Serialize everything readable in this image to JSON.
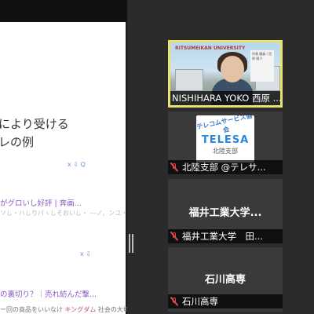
{
  "shared_screen": {
    "slide_lines": [
      "により受ける",
      "レの例"
    ],
    "ctrl_1": "x  ⇩  Q",
    "link_1": "がグロいし好評 | 奔画...",
    "faint_1": "ソし・ハしりパヽしそおいし・  ―ノ、ンユ・",
    "ctrl_2": "x  ⇩",
    "link_2": "の裏切り？｜売れ紡んだ撃...",
    "bottom_prefix": "ー回の商品をいいなけ ",
    "bottom_highlight": "キングダム",
    "bottom_suffix": " 社会の大切"
  },
  "participants": [
    {
      "name": "NISHIHARA YOKO 西原 ...",
      "type": "video",
      "active": true,
      "video_logo": "RITSUMEIKAN UNIVERSITY",
      "video_card": "所属 職員 / 西原 陽子"
    },
    {
      "name": "北陸支部 @テレサ...",
      "type": "avatar",
      "muted": true,
      "avatar_arc": "テレコムサービス協会",
      "avatar_brand": "TELESA",
      "avatar_branch": "北陸支部"
    },
    {
      "name": "福井工業大学　田...",
      "type": "name",
      "muted": true,
      "display_name": "福井工業大学..."
    },
    {
      "name": "石川高専",
      "type": "name",
      "muted": true,
      "display_name": "石川高専"
    }
  ]
}
